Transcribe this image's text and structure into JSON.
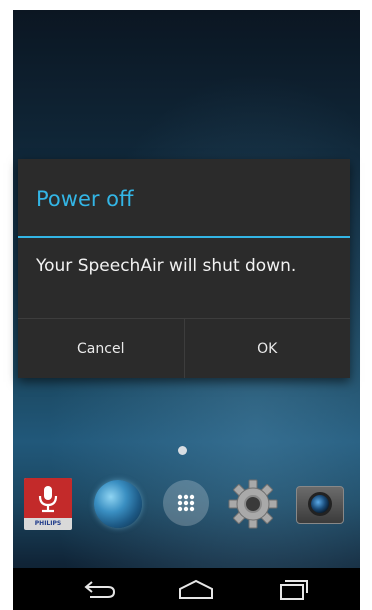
{
  "dialog": {
    "title": "Power off",
    "message": "Your SpeechAir will shut down.",
    "cancel_label": "Cancel",
    "ok_label": "OK"
  },
  "dock": {
    "philips_label": "PHILIPS",
    "icons": [
      "microphone-icon",
      "globe-icon",
      "app-drawer-icon",
      "settings-gear-icon",
      "camera-icon"
    ]
  },
  "navbar": {
    "icons": [
      "back-icon",
      "home-icon",
      "recent-apps-icon"
    ]
  },
  "colors": {
    "accent": "#33b5e5",
    "dialog_bg": "#2b2b2b",
    "brand_red": "#c32a2a"
  }
}
